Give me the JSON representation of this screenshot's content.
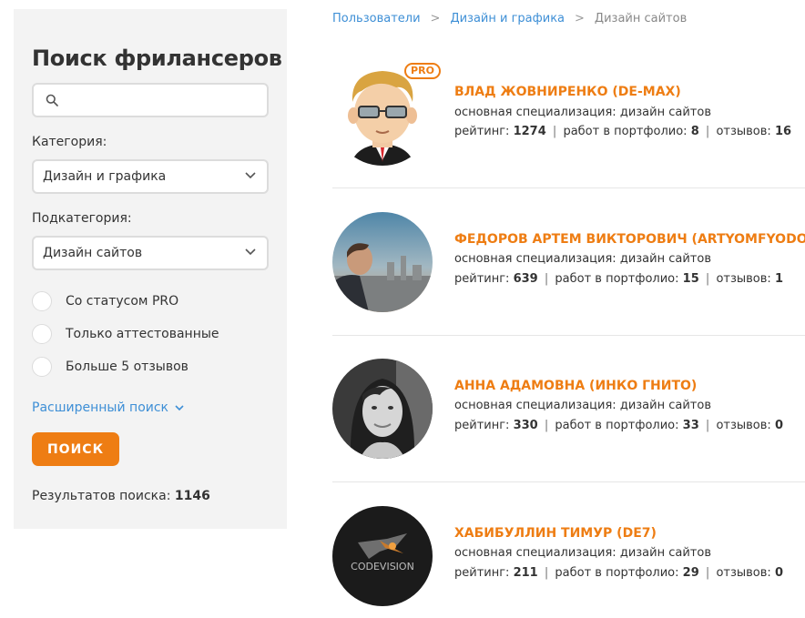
{
  "sidebar": {
    "title": "Поиск фрилансеров",
    "search": {
      "placeholder": "",
      "value": ""
    },
    "category_label": "Категория:",
    "category_value": "Дизайн и графика",
    "subcategory_label": "Подкатегория:",
    "subcategory_value": "Дизайн сайтов",
    "checkboxes": [
      {
        "label": "Со статусом PRO"
      },
      {
        "label": "Только аттестованные"
      },
      {
        "label": "Больше 5 отзывов"
      }
    ],
    "advanced_link": "Расширенный поиск",
    "search_button": "ПОИСК",
    "results_label": "Результатов поиска:",
    "results_count": "1146"
  },
  "breadcrumb": {
    "items": [
      "Пользователи",
      "Дизайн и графика"
    ],
    "separator": ">",
    "current": "Дизайн сайтов"
  },
  "labels": {
    "spec_prefix": "основная специализация:",
    "rating": "рейтинг:",
    "portfolio": "работ в портфолио:",
    "reviews": "отзывов:",
    "separator": "|",
    "pro": "PRO"
  },
  "freelancers": [
    {
      "name": "ВЛАД ЖОВНИРЕНКО (DE-MAX)",
      "specialization": "дизайн сайтов",
      "rating": "1274",
      "portfolio": "8",
      "reviews": "16",
      "pro": true
    },
    {
      "name": "ФЕДОРОВ АРТЕМ ВИКТОРОВИЧ (ARTYOMFYODOROV)",
      "specialization": "дизайн сайтов",
      "rating": "639",
      "portfolio": "15",
      "reviews": "1",
      "pro": false
    },
    {
      "name": "АННА АДАМОВНА (ИНКО ГНИТО)",
      "specialization": "дизайн сайтов",
      "rating": "330",
      "portfolio": "33",
      "reviews": "0",
      "pro": false
    },
    {
      "name": "ХАБИБУЛЛИН ТИМУР (DE7)",
      "specialization": "дизайн сайтов",
      "rating": "211",
      "portfolio": "29",
      "reviews": "0",
      "pro": false,
      "logo_text": "CODEVISION"
    }
  ],
  "colors": {
    "accent": "#ee7d13",
    "link": "#3e8fd6",
    "sidebar_bg": "#f3f3f3"
  }
}
